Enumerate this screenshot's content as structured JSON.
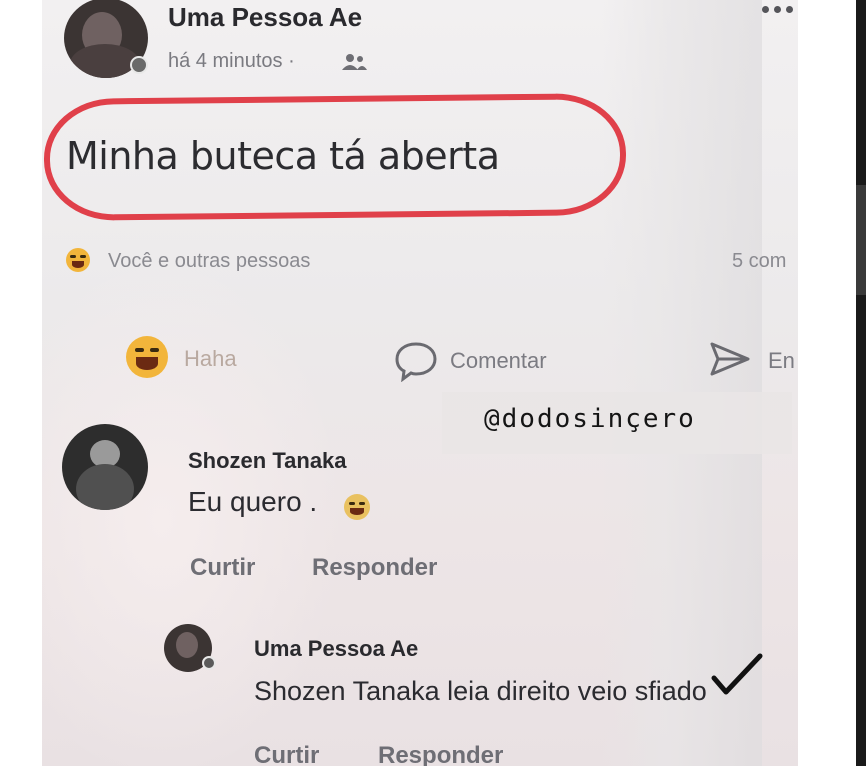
{
  "post": {
    "author": "Uma Pessoa Ae",
    "time": "há 4 minutos ·",
    "audience_icon": "friends-icon",
    "menu_icon": "more-dots-icon",
    "text": "Minha buteca tá aberta",
    "reactions_text": "Você e outras pessoas",
    "comments_count": "5 com",
    "actions": {
      "haha": "Haha",
      "comment": "Comentar",
      "share": "En"
    }
  },
  "watermark": "@dodosinçero",
  "comments": [
    {
      "author": "Shozen Tanaka",
      "text": "Eu quero .",
      "like": "Curtir",
      "reply": "Responder"
    },
    {
      "author": "Uma Pessoa Ae",
      "text": "Shozen Tanaka leia direito veio sfiado",
      "like": "Curtir",
      "reply": "Responder"
    }
  ],
  "colors": {
    "highlight_circle": "#e0404a",
    "checkmark": "#111111"
  }
}
